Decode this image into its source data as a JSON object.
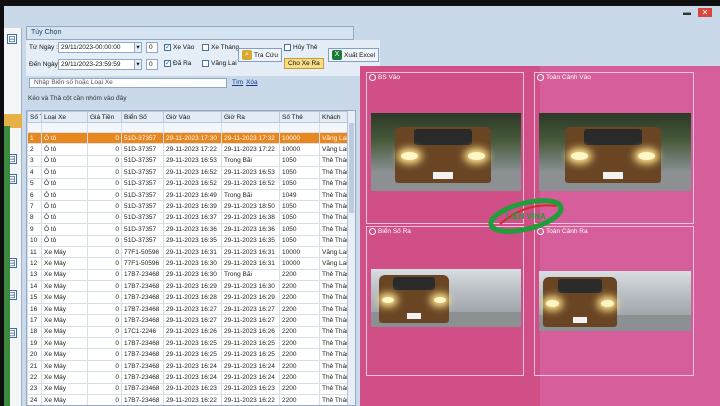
{
  "window": {
    "min_label": "▬",
    "close_label": "✕"
  },
  "left_strip": {
    "buttons": [
      "⊟",
      "⊟",
      "⊟",
      "⊟",
      "⊟",
      "⊟"
    ]
  },
  "options": {
    "header": "Tùy Chọn",
    "from_label": "Từ Ngày :",
    "from_value": "29/11/2023-00:00:00",
    "to_label": "Đến Ngày:",
    "to_value": "29/11/2023-23:59:59",
    "spin_from": "0",
    "spin_to": "0",
    "chk_xe_vao": "Xe Vào",
    "chk_xe_thang": "Xe Tháng",
    "chk_da_ra": "Đã Ra",
    "chk_vang_lai": "Vãng Lai",
    "chk_huy_the": "Hủy Thẻ",
    "btn_tra_cuu": "Tra Cứu",
    "btn_cho_xe_ra": "Cho Xe Ra",
    "btn_xuat_excel": "Xuất Excel"
  },
  "search": {
    "placeholder": "Nhập Biển số hoặc Loại Xe",
    "find_label": "Tìm",
    "clear_label": "Xóa"
  },
  "group_hint": "Kéo và Thả cột cần nhóm vào đây",
  "grid": {
    "columns": [
      "Số T",
      "Loại Xe",
      "Giá Tiền",
      "Biển Số",
      "Giờ Vào",
      "Giờ Ra",
      "Số Thẻ",
      "Khách"
    ],
    "rows": [
      [
        "1",
        "Ô tô",
        "0",
        "51D-37357",
        "29-11-2023 17:30",
        "29-11-2023 17:32",
        "10000",
        "Vãng Lai"
      ],
      [
        "2",
        "Ô tô",
        "0",
        "51D-37357",
        "29-11-2023 17:22",
        "29-11-2023 17:22",
        "10000",
        "Vãng Lai"
      ],
      [
        "3",
        "Ô tô",
        "0",
        "51D-37357",
        "29-11-2023 16:53",
        "Trong Bãi",
        "1050",
        "Thẻ Tháng"
      ],
      [
        "4",
        "Ô tô",
        "0",
        "51D-37357",
        "29-11-2023 16:52",
        "29-11-2023 16:53",
        "1050",
        "Thẻ Tháng"
      ],
      [
        "5",
        "Ô tô",
        "0",
        "51D-37357",
        "29-11-2023 16:52",
        "29-11-2023 16:52",
        "1050",
        "Thẻ Tháng"
      ],
      [
        "6",
        "Ô tô",
        "0",
        "51D-37357",
        "29-11-2023 16:49",
        "Trong Bãi",
        "1049",
        "Thẻ Tháng"
      ],
      [
        "7",
        "Ô tô",
        "0",
        "51D-37357",
        "29-11-2023 16:39",
        "29-11-2023 18:50",
        "1050",
        "Thẻ Tháng"
      ],
      [
        "8",
        "Ô tô",
        "0",
        "51D-37357",
        "29-11-2023 16:37",
        "29-11-2023 16:38",
        "1050",
        "Thẻ Tháng"
      ],
      [
        "9",
        "Ô tô",
        "0",
        "51D-37357",
        "29-11-2023 16:36",
        "29-11-2023 16:36",
        "1050",
        "Thẻ Tháng"
      ],
      [
        "10",
        "Ô tô",
        "0",
        "51D-37357",
        "29-11-2023 16:35",
        "29-11-2023 16:35",
        "1050",
        "Thẻ Tháng"
      ],
      [
        "11",
        "Xe Máy",
        "0",
        "77F1-50596",
        "29-11-2023 16:31",
        "29-11-2023 16:31",
        "10000",
        "Vãng Lai"
      ],
      [
        "12",
        "Xe Máy",
        "0",
        "77F1-50596",
        "29-11-2023 16:30",
        "29-11-2023 16:31",
        "10000",
        "Vãng Lai"
      ],
      [
        "13",
        "Xe Máy",
        "0",
        "17B7-23468",
        "29-11-2023 16:30",
        "Trong Bãi",
        "2200",
        "Thẻ Tháng"
      ],
      [
        "14",
        "Xe Máy",
        "0",
        "17B7-23468",
        "29-11-2023 16:29",
        "29-11-2023 16:30",
        "2200",
        "Thẻ Tháng"
      ],
      [
        "15",
        "Xe Máy",
        "0",
        "17B7-23468",
        "29-11-2023 16:28",
        "29-11-2023 16:29",
        "2200",
        "Thẻ Tháng"
      ],
      [
        "16",
        "Xe Máy",
        "0",
        "17B7-23468",
        "29-11-2023 16:27",
        "29-11-2023 16:27",
        "2200",
        "Thẻ Tháng"
      ],
      [
        "17",
        "Xe Máy",
        "0",
        "17B7-23468",
        "29-11-2023 16:27",
        "29-11-2023 16:27",
        "2200",
        "Thẻ Tháng"
      ],
      [
        "18",
        "Xe Máy",
        "0",
        "17C1-2246",
        "29-11-2023 16:26",
        "29-11-2023 16:26",
        "2200",
        "Thẻ Tháng"
      ],
      [
        "19",
        "Xe Máy",
        "0",
        "17B7-23468",
        "29-11-2023 16:25",
        "29-11-2023 16:25",
        "2200",
        "Thẻ Tháng"
      ],
      [
        "20",
        "Xe Máy",
        "0",
        "17B7-23468",
        "29-11-2023 16:25",
        "29-11-2023 16:25",
        "2200",
        "Thẻ Tháng"
      ],
      [
        "21",
        "Xe Máy",
        "0",
        "17B7-23468",
        "29-11-2023 16:24",
        "29-11-2023 16:24",
        "2200",
        "Thẻ Tháng"
      ],
      [
        "22",
        "Xe Máy",
        "0",
        "17B7-23468",
        "29-11-2023 16:24",
        "29-11-2023 16:24",
        "2200",
        "Thẻ Tháng"
      ],
      [
        "23",
        "Xe Máy",
        "0",
        "17B7-23468",
        "29-11-2023 16:23",
        "29-11-2023 16:23",
        "2200",
        "Thẻ Tháng"
      ],
      [
        "24",
        "Xe Máy",
        "0",
        "17B7-23468",
        "29-11-2023 16:22",
        "29-11-2023 16:22",
        "2200",
        "Thẻ Tháng"
      ]
    ],
    "selected_row": 0
  },
  "cameras": {
    "bs_vao": "BS Vào",
    "toan_canh_vao": "Toàn Cảnh Vào",
    "bien_so_ra": "Biển Số Ra",
    "toan_canh_ra": "Toàn Cảnh Ra"
  },
  "logo_text": "LIÊN VINA",
  "colors": {
    "selected_row": "#e8871e",
    "camera_bg": "#d65e9a",
    "logo_green": "#1f9e3a",
    "logo_red": "#d42a2a"
  }
}
